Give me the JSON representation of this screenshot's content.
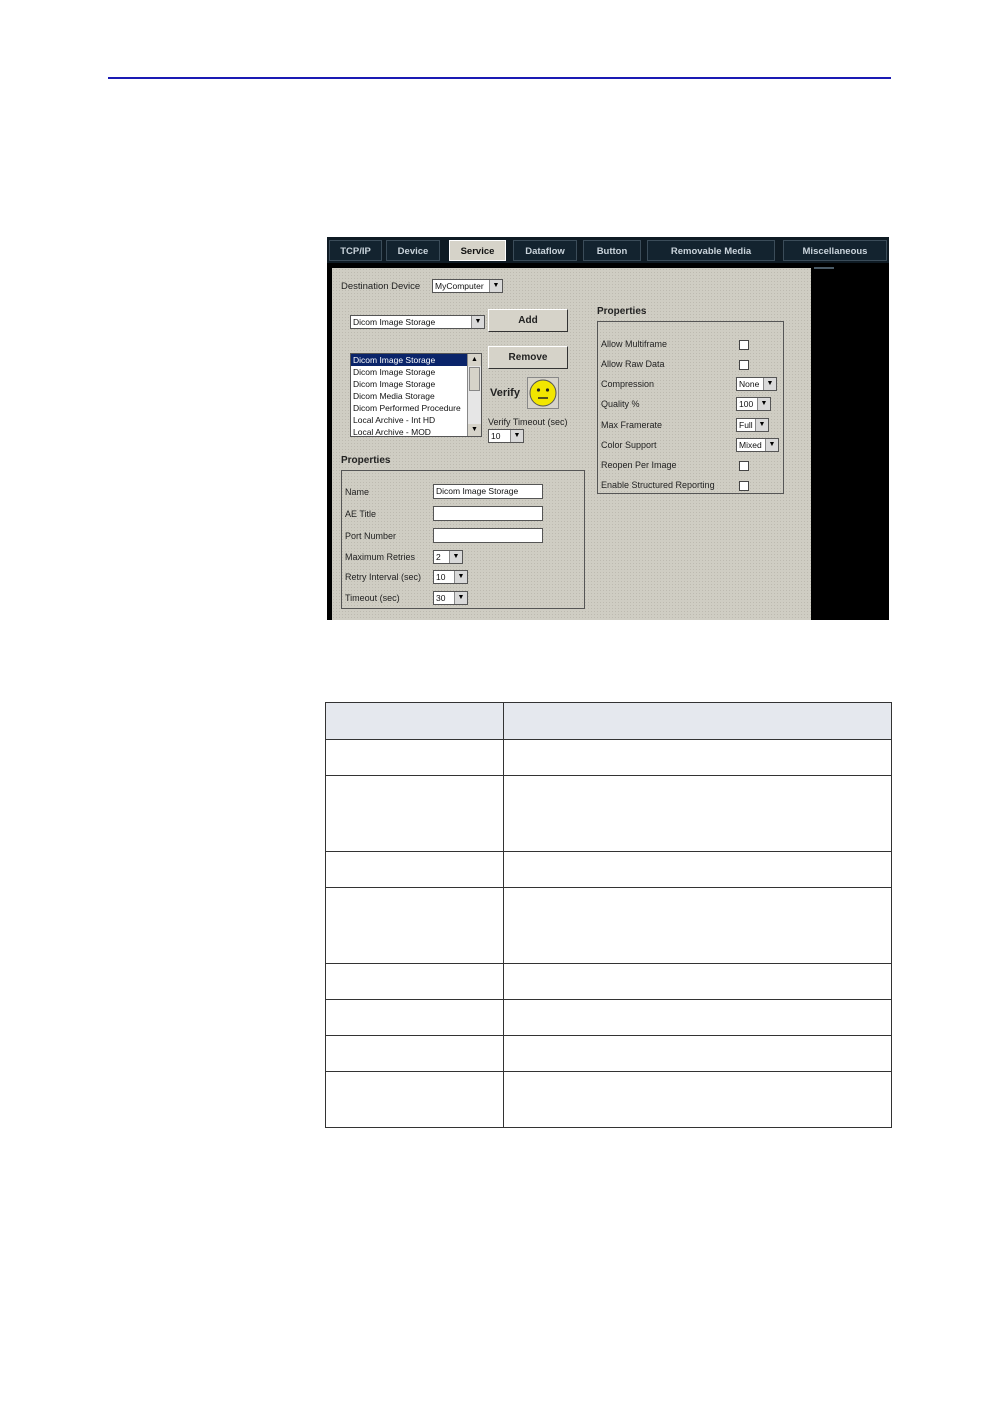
{
  "tabs": [
    "TCP/IP",
    "Device",
    "Service",
    "Dataflow",
    "Button",
    "Removable Media",
    "Miscellaneous"
  ],
  "active_tab": "Service",
  "destination": {
    "label": "Destination Device",
    "value": "MyComputer"
  },
  "service_select": {
    "value": "Dicom Image Storage"
  },
  "buttons": {
    "add": "Add",
    "remove": "Remove",
    "verify": "Verify"
  },
  "service_list": [
    "Dicom Image Storage",
    "Dicom Image Storage",
    "Dicom Image Storage",
    "Dicom Media Storage",
    "Dicom Performed Procedure",
    "Local Archive - Int HD",
    "Local Archive - MOD"
  ],
  "verify_timeout": {
    "label": "Verify Timeout (sec)",
    "value": "10"
  },
  "left_properties": {
    "header": "Properties",
    "name_label": "Name",
    "name_value": "Dicom Image Storage",
    "ae_title_label": "AE Title",
    "ae_title_value": "",
    "port_label": "Port Number",
    "port_value": "",
    "max_retries_label": "Maximum Retries",
    "max_retries_value": "2",
    "retry_interval_label": "Retry Interval (sec)",
    "retry_interval_value": "10",
    "timeout_label": "Timeout (sec)",
    "timeout_value": "30"
  },
  "right_properties": {
    "header": "Properties",
    "allow_multiframe": "Allow Multiframe",
    "allow_raw_data": "Allow Raw Data",
    "compression_label": "Compression",
    "compression_value": "None",
    "quality_label": "Quality %",
    "quality_value": "100",
    "max_framerate_label": "Max Framerate",
    "max_framerate_value": "Full",
    "color_support_label": "Color Support",
    "color_support_value": "Mixed",
    "reopen_per_image": "Reopen Per Image",
    "enable_structured_reporting": "Enable Structured Reporting"
  },
  "colors": {
    "rule": "#1a1ab4",
    "tab_bg": "#13232f",
    "panel_bg": "#cfcdc3",
    "selection": "#0a246a",
    "smiley": "#f2e600",
    "table_header": "#e5e8ee"
  }
}
